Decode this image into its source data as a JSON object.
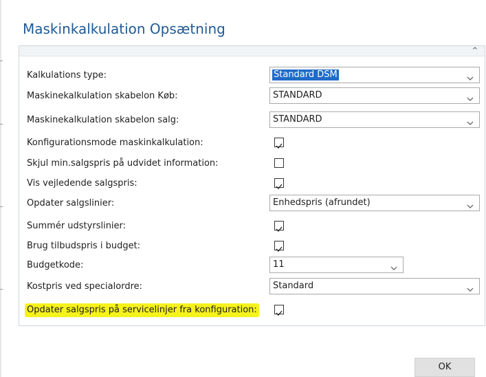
{
  "dialog": {
    "title": "Maskinkalkulation Opsætning"
  },
  "fields": [
    {
      "label": "Kalkulations type:",
      "type": "select",
      "value": "Standard DSM",
      "selected": true
    },
    {
      "label": "Maskinekalkulation skabelon Køb:",
      "type": "select",
      "value": "STANDARD"
    },
    {
      "label": "Maskinekalkulation skabelon salg:",
      "type": "select",
      "value": "STANDARD"
    },
    {
      "label": "Konfigurationsmode maskinkalkulation:",
      "type": "checkbox",
      "checked": true
    },
    {
      "label": "Skjul min.salgspris på udvidet information:",
      "type": "checkbox",
      "checked": false
    },
    {
      "label": "Vis vejledende salgspris:",
      "type": "checkbox",
      "checked": true
    },
    {
      "label": "Opdater salgslinier:",
      "type": "select",
      "value": "Enhedspris (afrundet)"
    },
    {
      "label": "Summér udstyrslinier:",
      "type": "checkbox",
      "checked": true
    },
    {
      "label": "Brug tilbudspris i budget:",
      "type": "checkbox",
      "checked": true
    },
    {
      "label": "Budgetkode:",
      "type": "select",
      "value": "11",
      "short": true
    },
    {
      "label": "Kostpris ved specialordre:",
      "type": "select",
      "value": "Standard"
    },
    {
      "label": "Opdater salgspris på servicelinjer fra konfiguration:",
      "type": "checkbox",
      "checked": true,
      "highlighted": true
    }
  ],
  "highlight_color": "#f6f21c",
  "accent_color": "#1f5a96",
  "icons": {
    "collapse": "chevron-up-icon",
    "dropdown": "chevron-down-icon",
    "checked": "check-icon"
  },
  "footer": {
    "ok_label": "OK"
  }
}
